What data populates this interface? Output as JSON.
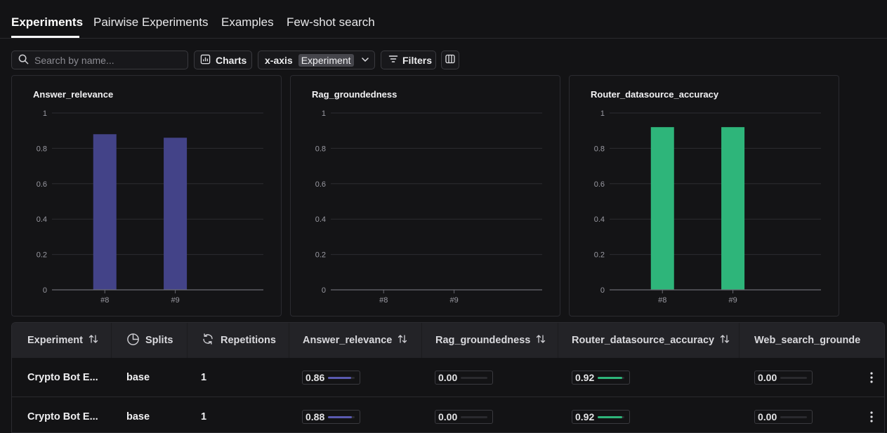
{
  "tabs": {
    "experiments": "Experiments",
    "pairwise": "Pairwise Experiments",
    "examples": "Examples",
    "fewshot": "Few-shot search"
  },
  "toolbar": {
    "search_placeholder": "Search by name...",
    "charts_label": "Charts",
    "xaxis_label": "x-axis",
    "xaxis_value": "Experiment",
    "filters_label": "Filters"
  },
  "chart_data": [
    {
      "type": "bar",
      "title": "Answer_relevance",
      "categories": [
        "#8",
        "#9"
      ],
      "values": [
        0.88,
        0.86
      ],
      "color": "#434388",
      "ylim": [
        0,
        1
      ],
      "yticks": [
        "1",
        "0.8",
        "0.6",
        "0.4",
        "0.2",
        "0"
      ],
      "grid": true
    },
    {
      "type": "bar",
      "title": "Rag_groundedness",
      "categories": [
        "#8",
        "#9"
      ],
      "values": [
        0,
        0
      ],
      "color": "#434388",
      "ylim": [
        0,
        1
      ],
      "yticks": [
        "1",
        "0.8",
        "0.6",
        "0.4",
        "0.2",
        "0"
      ],
      "grid": true
    },
    {
      "type": "bar",
      "title": "Router_datasource_accuracy",
      "categories": [
        "#8",
        "#9"
      ],
      "values": [
        0.92,
        0.92
      ],
      "color": "#2eb57a",
      "ylim": [
        0,
        1
      ],
      "yticks": [
        "1",
        "0.8",
        "0.6",
        "0.4",
        "0.2",
        "0"
      ],
      "grid": true
    }
  ],
  "table": {
    "headers": {
      "experiment": "Experiment",
      "splits": "Splits",
      "repetitions": "Repetitions",
      "answer_relevance": "Answer_relevance",
      "rag_groundedness": "Rag_groundedness",
      "router_datasource_accuracy": "Router_datasource_accuracy",
      "web_search": "Web_search_grounde"
    },
    "rows": [
      {
        "experiment": "Crypto Bot E...",
        "splits": "base",
        "repetitions": "1",
        "answer_relevance": "0.86",
        "answer_relevance_frac": 0.86,
        "rag_groundedness": "0.00",
        "rag_groundedness_frac": 0,
        "router_accuracy": "0.92",
        "router_accuracy_frac": 0.92,
        "web_search": "0.00",
        "web_search_frac": 0
      },
      {
        "experiment": "Crypto Bot E...",
        "splits": "base",
        "repetitions": "1",
        "answer_relevance": "0.88",
        "answer_relevance_frac": 0.88,
        "rag_groundedness": "0.00",
        "rag_groundedness_frac": 0,
        "router_accuracy": "0.92",
        "router_accuracy_frac": 0.92,
        "web_search": "0.00",
        "web_search_frac": 0
      }
    ]
  },
  "colors": {
    "purple": "#434388",
    "purple_light": "#5a5ab0",
    "green": "#2eb57a"
  }
}
